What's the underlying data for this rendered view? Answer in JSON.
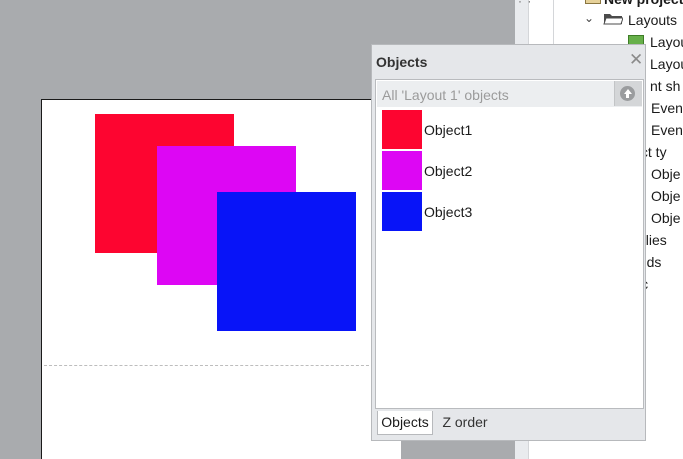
{
  "project_tree": {
    "root_label": "New project",
    "layouts_label": "Layouts",
    "items": [
      "Layout",
      "Layout",
      "nt sh",
      "Event",
      "Event",
      "ject ty",
      "Obje",
      "Obje",
      "Obje",
      "milies",
      "unds",
      "sic",
      "s"
    ]
  },
  "objects_panel": {
    "title": "Objects",
    "close_glyph": "✕",
    "filter_text": "All 'Layout 1' objects",
    "objects": [
      {
        "name": "Object1",
        "color": "#fd0530"
      },
      {
        "name": "Object2",
        "color": "#dd06f4"
      },
      {
        "name": "Object3",
        "color": "#0814f8"
      }
    ],
    "tabs": [
      "Objects",
      "Z order"
    ],
    "active_tab": "Objects"
  },
  "canvas": {
    "shape_colors": {
      "object1": "#fd0530",
      "object2": "#dd06f4",
      "object3": "#0814f8"
    }
  },
  "icons": [
    "folder-icon",
    "layout-icon",
    "chevron-down-icon",
    "close-icon",
    "up-arrow-icon"
  ]
}
